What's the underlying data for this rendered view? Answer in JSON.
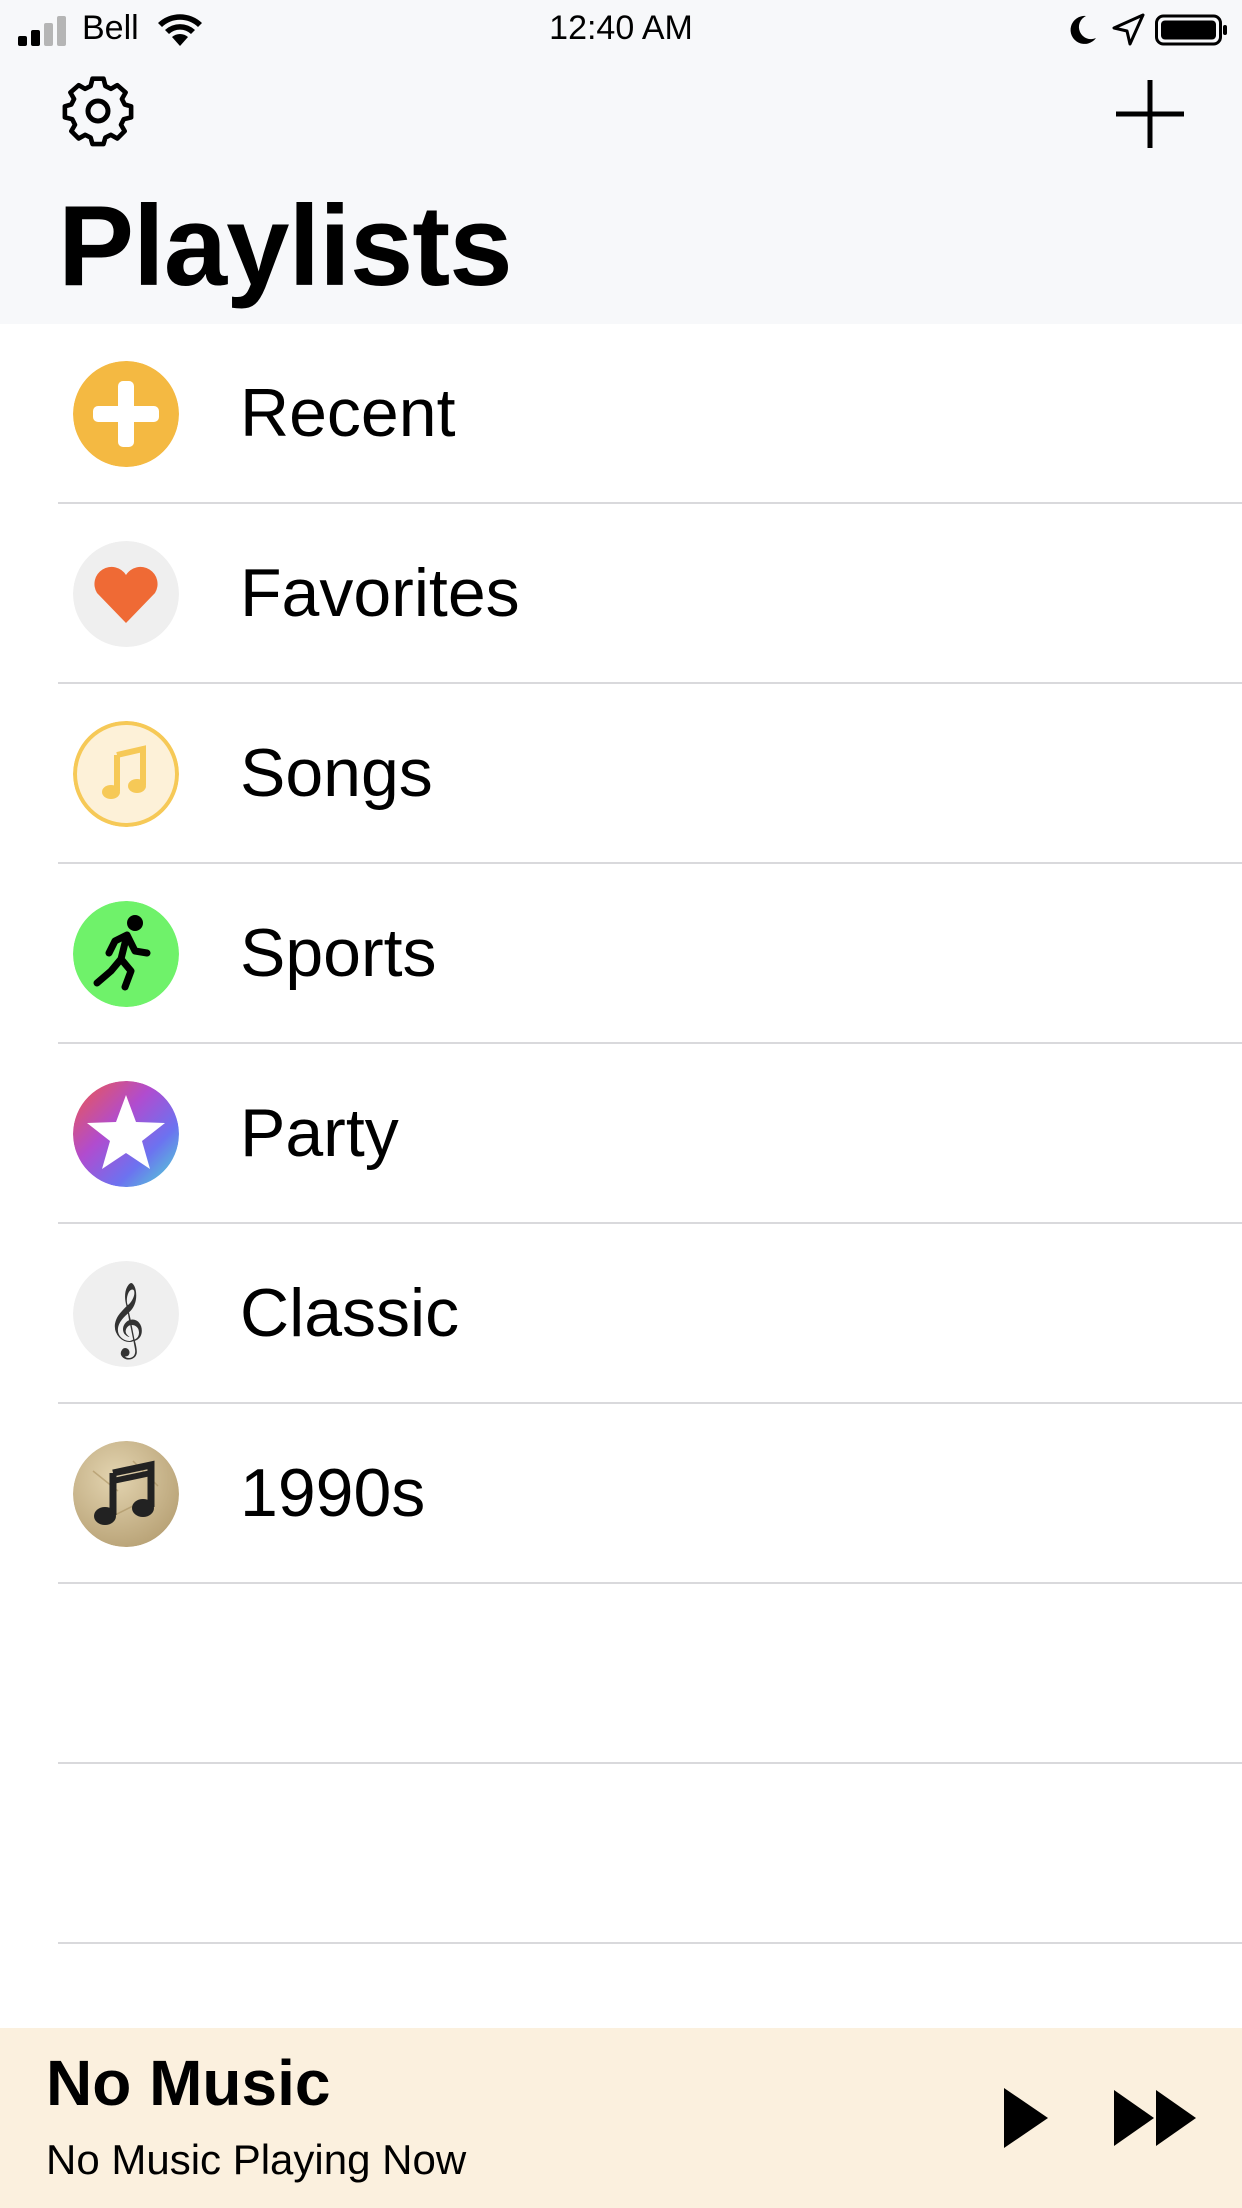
{
  "status_bar": {
    "carrier": "Bell",
    "time": "12:40 AM"
  },
  "header": {
    "title": "Playlists",
    "settings_icon": "gear-icon",
    "add_icon": "plus-icon"
  },
  "playlists": [
    {
      "label": "Recent",
      "icon": "plus-circle-icon",
      "color": "#f4b942"
    },
    {
      "label": "Favorites",
      "icon": "heart-icon",
      "color": "#ef6a35"
    },
    {
      "label": "Songs",
      "icon": "music-note-icon",
      "color": "#f6c957"
    },
    {
      "label": "Sports",
      "icon": "runner-icon",
      "color": "#6ff26a"
    },
    {
      "label": "Party",
      "icon": "star-icon",
      "color": "#8a5cf6"
    },
    {
      "label": "Classic",
      "icon": "treble-clef-icon",
      "color": "#efefef"
    },
    {
      "label": "1990s",
      "icon": "music-notes-icon",
      "color": "#c9b48a"
    }
  ],
  "player": {
    "title": "No Music",
    "subtitle": "No Music Playing Now",
    "background": "#fbf0de"
  }
}
